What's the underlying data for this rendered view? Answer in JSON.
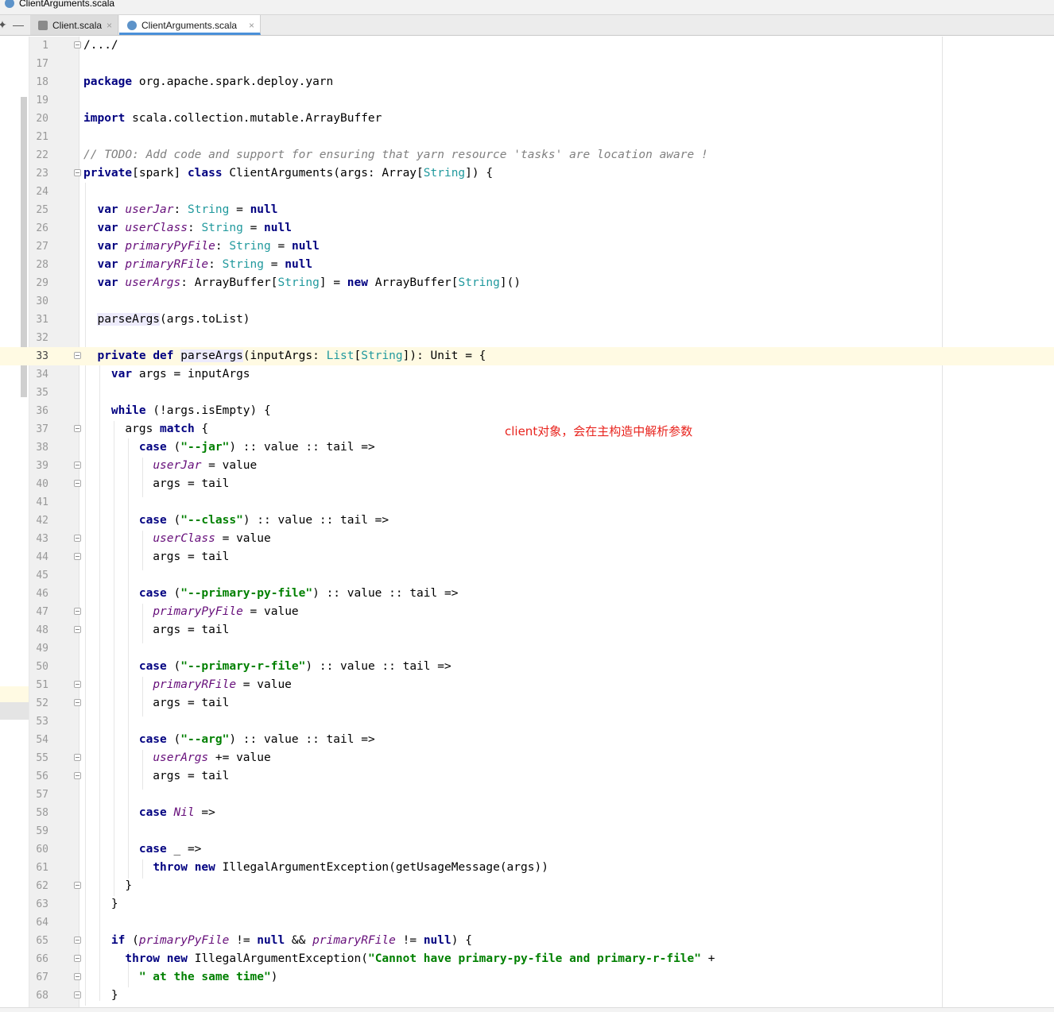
{
  "window": {
    "title": "ClientArguments.scala"
  },
  "tabs": [
    {
      "label": "Client.scala",
      "close": "×",
      "active": false
    },
    {
      "label": "ClientArguments.scala",
      "close": "×",
      "active": true
    }
  ],
  "toolbar": {
    "pin_glyph": "✦",
    "minimize_glyph": "—"
  },
  "annotation": "client对象，会在主构造中解析参数",
  "lines": [
    {
      "n": "1",
      "fold": true,
      "segs": [
        [
          "plain",
          "/.../"
        ]
      ]
    },
    {
      "n": "17",
      "segs": []
    },
    {
      "n": "18",
      "segs": [
        [
          "kw",
          "package"
        ],
        [
          "plain",
          " org.apache.spark.deploy.yarn"
        ]
      ]
    },
    {
      "n": "19",
      "segs": []
    },
    {
      "n": "20",
      "segs": [
        [
          "kw",
          "import"
        ],
        [
          "plain",
          " scala.collection.mutable.ArrayBuffer"
        ]
      ]
    },
    {
      "n": "21",
      "segs": []
    },
    {
      "n": "22",
      "segs": [
        [
          "cmt",
          "// TODO: Add code and support for ensuring that yarn resource 'tasks' are location aware !"
        ]
      ]
    },
    {
      "n": "23",
      "fold": true,
      "segs": [
        [
          "kw",
          "private"
        ],
        [
          "plain",
          "[spark] "
        ],
        [
          "kw",
          "class"
        ],
        [
          "plain",
          " ClientArguments(args: Array["
        ],
        [
          "typ",
          "String"
        ],
        [
          "plain",
          "]) {"
        ]
      ]
    },
    {
      "n": "24",
      "segs": []
    },
    {
      "n": "25",
      "segs": [
        [
          "plain",
          "  "
        ],
        [
          "kw",
          "var"
        ],
        [
          "plain",
          " "
        ],
        [
          "fld",
          "userJar"
        ],
        [
          "plain",
          ": "
        ],
        [
          "typ",
          "String"
        ],
        [
          "plain",
          " = "
        ],
        [
          "kw",
          "null"
        ]
      ]
    },
    {
      "n": "26",
      "segs": [
        [
          "plain",
          "  "
        ],
        [
          "kw",
          "var"
        ],
        [
          "plain",
          " "
        ],
        [
          "fld",
          "userClass"
        ],
        [
          "plain",
          ": "
        ],
        [
          "typ",
          "String"
        ],
        [
          "plain",
          " = "
        ],
        [
          "kw",
          "null"
        ]
      ]
    },
    {
      "n": "27",
      "segs": [
        [
          "plain",
          "  "
        ],
        [
          "kw",
          "var"
        ],
        [
          "plain",
          " "
        ],
        [
          "fld",
          "primaryPyFile"
        ],
        [
          "plain",
          ": "
        ],
        [
          "typ",
          "String"
        ],
        [
          "plain",
          " = "
        ],
        [
          "kw",
          "null"
        ]
      ]
    },
    {
      "n": "28",
      "segs": [
        [
          "plain",
          "  "
        ],
        [
          "kw",
          "var"
        ],
        [
          "plain",
          " "
        ],
        [
          "fld",
          "primaryRFile"
        ],
        [
          "plain",
          ": "
        ],
        [
          "typ",
          "String"
        ],
        [
          "plain",
          " = "
        ],
        [
          "kw",
          "null"
        ]
      ]
    },
    {
      "n": "29",
      "segs": [
        [
          "plain",
          "  "
        ],
        [
          "kw",
          "var"
        ],
        [
          "plain",
          " "
        ],
        [
          "fld",
          "userArgs"
        ],
        [
          "plain",
          ": ArrayBuffer["
        ],
        [
          "typ",
          "String"
        ],
        [
          "plain",
          "] = "
        ],
        [
          "kw",
          "new"
        ],
        [
          "plain",
          " ArrayBuffer["
        ],
        [
          "typ",
          "String"
        ],
        [
          "plain",
          "]()"
        ]
      ]
    },
    {
      "n": "30",
      "segs": []
    },
    {
      "n": "31",
      "segs": [
        [
          "plain",
          "  "
        ],
        [
          "hl",
          "parseArgs"
        ],
        [
          "plain",
          "(args.toList)"
        ]
      ]
    },
    {
      "n": "32",
      "segs": []
    },
    {
      "n": "33",
      "fold": true,
      "current": true,
      "segs": [
        [
          "plain",
          "  "
        ],
        [
          "kw",
          "private"
        ],
        [
          "plain",
          " "
        ],
        [
          "kw",
          "def"
        ],
        [
          "plain",
          " "
        ],
        [
          "hl",
          "parseArgs"
        ],
        [
          "plain",
          "(inputArgs: "
        ],
        [
          "typ",
          "List"
        ],
        [
          "plain",
          "["
        ],
        [
          "typ",
          "String"
        ],
        [
          "plain",
          "]): Unit = {"
        ]
      ]
    },
    {
      "n": "34",
      "segs": [
        [
          "plain",
          "    "
        ],
        [
          "kw",
          "var"
        ],
        [
          "plain",
          " args = inputArgs"
        ]
      ]
    },
    {
      "n": "35",
      "segs": []
    },
    {
      "n": "36",
      "segs": [
        [
          "plain",
          "    "
        ],
        [
          "kw",
          "while"
        ],
        [
          "plain",
          " (!args.isEmpty) {"
        ]
      ]
    },
    {
      "n": "37",
      "fold": true,
      "segs": [
        [
          "plain",
          "      args "
        ],
        [
          "kw",
          "match"
        ],
        [
          "plain",
          " {"
        ]
      ]
    },
    {
      "n": "38",
      "segs": [
        [
          "plain",
          "        "
        ],
        [
          "kw",
          "case"
        ],
        [
          "plain",
          " ("
        ],
        [
          "str",
          "\"--jar\""
        ],
        [
          "plain",
          ") :: value :: tail =>"
        ]
      ]
    },
    {
      "n": "39",
      "fold": true,
      "segs": [
        [
          "plain",
          "          "
        ],
        [
          "fld",
          "userJar"
        ],
        [
          "plain",
          " = value"
        ]
      ]
    },
    {
      "n": "40",
      "fold": true,
      "segs": [
        [
          "plain",
          "          args = tail"
        ]
      ]
    },
    {
      "n": "41",
      "segs": []
    },
    {
      "n": "42",
      "segs": [
        [
          "plain",
          "        "
        ],
        [
          "kw",
          "case"
        ],
        [
          "plain",
          " ("
        ],
        [
          "str",
          "\"--class\""
        ],
        [
          "plain",
          ") :: value :: tail =>"
        ]
      ]
    },
    {
      "n": "43",
      "fold": true,
      "segs": [
        [
          "plain",
          "          "
        ],
        [
          "fld",
          "userClass"
        ],
        [
          "plain",
          " = value"
        ]
      ]
    },
    {
      "n": "44",
      "fold": true,
      "segs": [
        [
          "plain",
          "          args = tail"
        ]
      ]
    },
    {
      "n": "45",
      "segs": []
    },
    {
      "n": "46",
      "segs": [
        [
          "plain",
          "        "
        ],
        [
          "kw",
          "case"
        ],
        [
          "plain",
          " ("
        ],
        [
          "str",
          "\"--primary-py-file\""
        ],
        [
          "plain",
          ") :: value :: tail =>"
        ]
      ]
    },
    {
      "n": "47",
      "fold": true,
      "segs": [
        [
          "plain",
          "          "
        ],
        [
          "fld",
          "primaryPyFile"
        ],
        [
          "plain",
          " = value"
        ]
      ]
    },
    {
      "n": "48",
      "fold": true,
      "segs": [
        [
          "plain",
          "          args = tail"
        ]
      ]
    },
    {
      "n": "49",
      "segs": []
    },
    {
      "n": "50",
      "segs": [
        [
          "plain",
          "        "
        ],
        [
          "kw",
          "case"
        ],
        [
          "plain",
          " ("
        ],
        [
          "str",
          "\"--primary-r-file\""
        ],
        [
          "plain",
          ") :: value :: tail =>"
        ]
      ]
    },
    {
      "n": "51",
      "fold": true,
      "segs": [
        [
          "plain",
          "          "
        ],
        [
          "fld",
          "primaryRFile"
        ],
        [
          "plain",
          " = value"
        ]
      ]
    },
    {
      "n": "52",
      "fold": true,
      "segs": [
        [
          "plain",
          "          args = tail"
        ]
      ]
    },
    {
      "n": "53",
      "segs": []
    },
    {
      "n": "54",
      "segs": [
        [
          "plain",
          "        "
        ],
        [
          "kw",
          "case"
        ],
        [
          "plain",
          " ("
        ],
        [
          "str",
          "\"--arg\""
        ],
        [
          "plain",
          ") :: value :: tail =>"
        ]
      ]
    },
    {
      "n": "55",
      "fold": true,
      "segs": [
        [
          "plain",
          "          "
        ],
        [
          "fld",
          "userArgs"
        ],
        [
          "plain",
          " += value"
        ]
      ]
    },
    {
      "n": "56",
      "fold": true,
      "segs": [
        [
          "plain",
          "          args = tail"
        ]
      ]
    },
    {
      "n": "57",
      "segs": []
    },
    {
      "n": "58",
      "segs": [
        [
          "plain",
          "        "
        ],
        [
          "kw",
          "case"
        ],
        [
          "plain",
          " "
        ],
        [
          "fld",
          "Nil"
        ],
        [
          "plain",
          " =>"
        ]
      ]
    },
    {
      "n": "59",
      "segs": []
    },
    {
      "n": "60",
      "segs": [
        [
          "plain",
          "        "
        ],
        [
          "kw",
          "case"
        ],
        [
          "plain",
          " _ =>"
        ]
      ]
    },
    {
      "n": "61",
      "segs": [
        [
          "plain",
          "          "
        ],
        [
          "kw",
          "throw"
        ],
        [
          "plain",
          " "
        ],
        [
          "kw",
          "new"
        ],
        [
          "plain",
          " IllegalArgumentException(getUsageMessage(args))"
        ]
      ]
    },
    {
      "n": "62",
      "fold": true,
      "segs": [
        [
          "plain",
          "      }"
        ]
      ]
    },
    {
      "n": "63",
      "segs": [
        [
          "plain",
          "    }"
        ]
      ]
    },
    {
      "n": "64",
      "segs": []
    },
    {
      "n": "65",
      "fold": true,
      "segs": [
        [
          "plain",
          "    "
        ],
        [
          "kw",
          "if"
        ],
        [
          "plain",
          " ("
        ],
        [
          "fld",
          "primaryPyFile"
        ],
        [
          "plain",
          " != "
        ],
        [
          "kw",
          "null"
        ],
        [
          "plain",
          " && "
        ],
        [
          "fld",
          "primaryRFile"
        ],
        [
          "plain",
          " != "
        ],
        [
          "kw",
          "null"
        ],
        [
          "plain",
          ") {"
        ]
      ]
    },
    {
      "n": "66",
      "fold": true,
      "segs": [
        [
          "plain",
          "      "
        ],
        [
          "kw",
          "throw"
        ],
        [
          "plain",
          " "
        ],
        [
          "kw",
          "new"
        ],
        [
          "plain",
          " IllegalArgumentException("
        ],
        [
          "str",
          "\"Cannot have primary-py-file and primary-r-file\""
        ],
        [
          "plain",
          " +"
        ]
      ]
    },
    {
      "n": "67",
      "fold": true,
      "segs": [
        [
          "plain",
          "        "
        ],
        [
          "str",
          "\" at the same time\""
        ],
        [
          "plain",
          ")"
        ]
      ]
    },
    {
      "n": "68",
      "fold": true,
      "segs": [
        [
          "plain",
          "    }"
        ]
      ]
    }
  ]
}
